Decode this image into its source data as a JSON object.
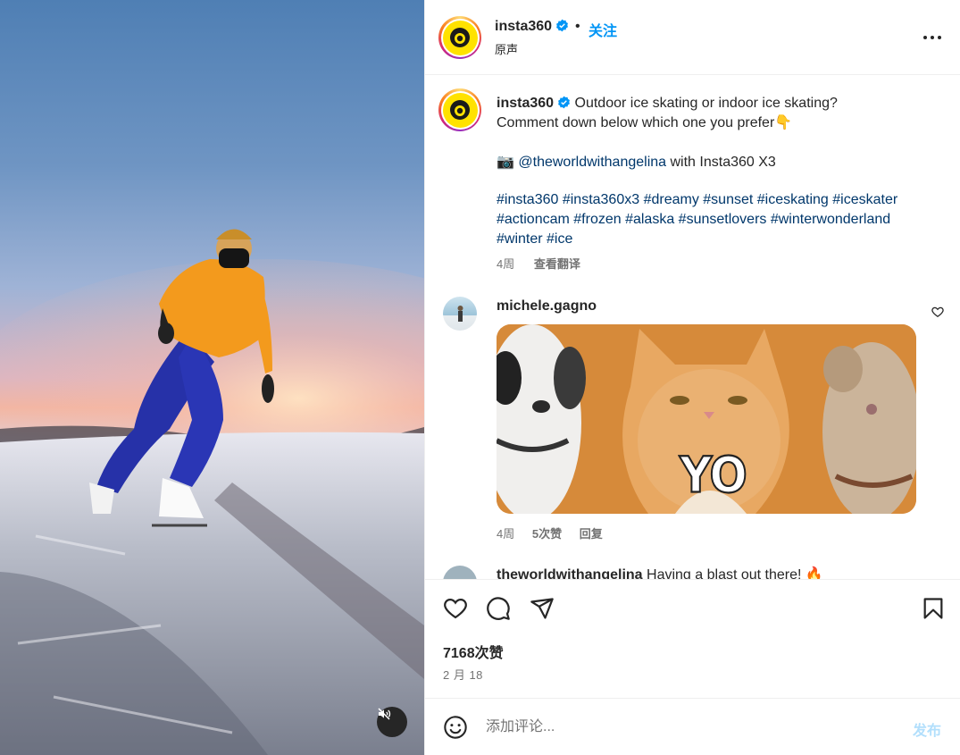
{
  "post": {
    "author": "insta360",
    "audio": "原声",
    "follow_label": "关注",
    "separator": "•",
    "caption": {
      "author": "insta360",
      "text_line1": "Outdoor ice skating or indoor ice skating?",
      "text_line2": "Comment down below which one you prefer",
      "point_emoji": "👇",
      "camera_emoji": "📷",
      "credit_handle": "@theworldwithangelina",
      "credit_suffix": "with Insta360 X3",
      "hashtags_line1": "#insta360 #insta360x3 #dreamy #sunset #iceskating #iceskater",
      "hashtags_line2": "#actioncam #frozen #alaska #sunsetlovers #winterwonderland",
      "hashtags_line3": "#winter #ice",
      "age": "4周",
      "translate_label": "查看翻译"
    },
    "comments": [
      {
        "user": "michele.gagno",
        "gif_text": "YO",
        "age": "4周",
        "likes": "5次赞",
        "reply_label": "回复"
      },
      {
        "user": "theworldwithangelina",
        "text": "Having a blast out there!",
        "emoji": "🔥"
      }
    ],
    "likes": "7168次赞",
    "date": "2 月 18"
  },
  "comment_box": {
    "placeholder": "添加评论...",
    "post_label": "发布"
  },
  "icons": {
    "verified": "verified-badge-icon",
    "more": "more-options-icon",
    "like": "heart-icon",
    "comment": "comment-icon",
    "share": "share-icon",
    "save": "bookmark-icon",
    "emoji": "emoji-icon",
    "mute": "speaker-muted-icon"
  },
  "colors": {
    "accent": "#0095f6",
    "link": "#00376b",
    "muted_text": "#737373",
    "post_disabled": "#b2dffc"
  }
}
